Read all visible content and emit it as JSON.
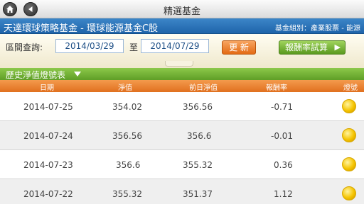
{
  "header": {
    "title": "精選基金",
    "home_icon": "home-icon",
    "back_icon": "back-arrow-icon"
  },
  "fund": {
    "name": "天達環球策略基金 - 環球能源基金C股",
    "group_label": "基金組別：產業股票 - 能源"
  },
  "filter": {
    "range_label": "區間查詢:",
    "start_date": "2014/03/29",
    "to_label": "至",
    "end_date": "2014/07/29",
    "update_label": "更 新",
    "calc_label": "報酬率試算",
    "calc_arrow": "▶"
  },
  "section": {
    "title": "歷史淨值燈號表"
  },
  "table": {
    "columns": [
      "日期",
      "淨值",
      "前日淨值",
      "報酬率",
      "燈號"
    ],
    "rows": [
      {
        "date": "2014-07-25",
        "nav": "354.02",
        "prev_nav": "356.56",
        "return": "-0.71",
        "signal": "yellow"
      },
      {
        "date": "2014-07-24",
        "nav": "356.56",
        "prev_nav": "356.6",
        "return": "-0.01",
        "signal": "yellow"
      },
      {
        "date": "2014-07-23",
        "nav": "356.6",
        "prev_nav": "355.32",
        "return": "0.36",
        "signal": "yellow"
      },
      {
        "date": "2014-07-22",
        "nav": "355.32",
        "prev_nav": "351.37",
        "return": "1.12",
        "signal": "yellow"
      }
    ]
  },
  "colors": {
    "fund_bar": "#2a74bb",
    "section_bar": "#6fae2e",
    "table_header": "#ea8433",
    "signal_yellow": "#f5c400"
  }
}
